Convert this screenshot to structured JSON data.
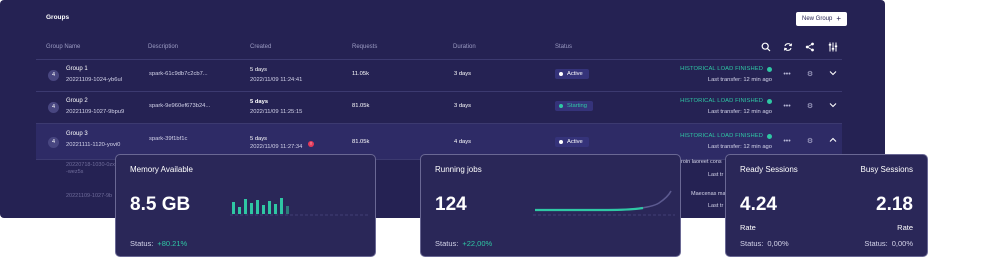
{
  "panel": {
    "title": "Groups",
    "new_group_label": "New Group",
    "new_group_icon": "+"
  },
  "columns": [
    "Group Name",
    "Description",
    "Created",
    "Requests",
    "Duration",
    "Status"
  ],
  "tools": [
    "search-icon",
    "refresh-icon",
    "share-icon",
    "column-settings-icon"
  ],
  "rows": [
    {
      "badge": "4",
      "name": "Group 1",
      "id": "20221109-1024-yb6ul",
      "description": "spark-61c9db7c2cb7...",
      "created_relative": "5 days",
      "created_absolute": "2022/11/09 11:24:41",
      "requests": "11.05k",
      "duration": "3 days",
      "status": "Active",
      "status_color": "#ffffff",
      "load_status": "HISTORICAL LOAD FINISHED",
      "last_transfer": "Last transfer:",
      "last_transfer_time": "12 min ago"
    },
    {
      "badge": "4",
      "name": "Group 2",
      "id": "20221109-1027-9bpu9",
      "description": "spark-9e960ef673b24...",
      "created_relative": "5 days",
      "created_absolute": "2022/11/09 11:25:15",
      "requests": "81.05k",
      "duration": "3 days",
      "status": "Starting",
      "status_color": "#2fc7a4",
      "load_status": "HISTORICAL LOAD FINISHED",
      "last_transfer": "Last transfer:",
      "last_transfer_time": "12 min ago"
    },
    {
      "badge": "4",
      "name": "Group 3",
      "id": "20221111-1120-yovi0",
      "description": "spark-39f1bf1c",
      "created_relative": "5 days",
      "created_absolute": "2022/11/09 11:27:34",
      "created_alert": "!",
      "requests": "81.05k",
      "duration": "4 days",
      "status": "Active",
      "status_color": "#ffffff",
      "load_status": "HISTORICAL LOAD FINISHED",
      "last_transfer": "Last transfer:",
      "last_transfer_time": "12 min ago"
    }
  ],
  "ghost_rows": {
    "id_a": "20220718-1030-0zx",
    "id_a_suffix": "-wez5s",
    "id_b": "20221109-1027-9b",
    "text_a": "roin laoreet cons",
    "text_b": "Maecenas ma",
    "last_a": "Last tr",
    "last_b": "Last tr"
  },
  "cards": {
    "memory": {
      "title": "Memory Available",
      "value": "8.5 GB",
      "status_label": "Status:",
      "status_delta": "+80.21%",
      "bars": [
        0.6,
        0.35,
        0.75,
        0.55,
        0.7,
        0.45,
        0.65,
        0.5,
        0.8,
        0.4
      ]
    },
    "jobs": {
      "title": "Running jobs",
      "value": "124",
      "status_label": "Status:",
      "status_delta": "+22,00%"
    },
    "sessions": {
      "ready_title": "Ready Sessions",
      "busy_title": "Busy Sessions",
      "ready_value": "4.24",
      "busy_value": "2.18",
      "ready_rate": "Rate",
      "busy_rate": "Rate",
      "ready_status_label": "Status:",
      "ready_status": "0,00%",
      "busy_status_label": "Status:",
      "busy_status": "0,00%"
    }
  },
  "colors": {
    "panel_bg": "#252253",
    "accent": "#2fc7a4",
    "alert": "#e63a5a"
  }
}
